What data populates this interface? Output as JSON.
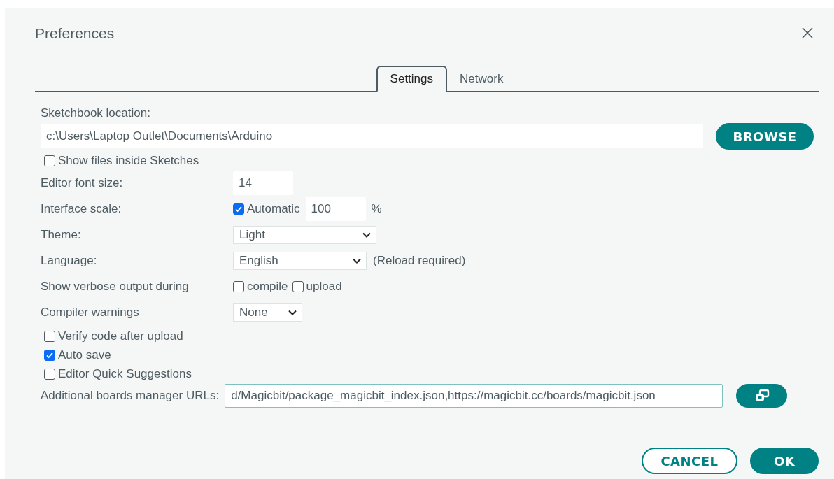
{
  "window": {
    "title": "Preferences"
  },
  "tabs": [
    {
      "label": "Settings",
      "selected": true
    },
    {
      "label": "Network",
      "selected": false
    }
  ],
  "sketchbook": {
    "label": "Sketchbook location:",
    "value": "c:\\Users\\Laptop Outlet\\Documents\\Arduino",
    "button": "BROWSE",
    "show_files": {
      "label": "Show files inside Sketches",
      "checked": false
    }
  },
  "settings": [
    {
      "kind": "input",
      "label": "Editor font size:",
      "value": "14"
    },
    {
      "kind": "scale",
      "label": "Interface scale:",
      "auto": {
        "label": "Automatic",
        "checked": true
      },
      "value": "100",
      "unit": "%"
    },
    {
      "kind": "select",
      "label": "Theme:",
      "value": "Light"
    },
    {
      "kind": "select",
      "label": "Language:",
      "value": "English",
      "note": "(Reload required)"
    },
    {
      "kind": "checks",
      "label": "Show verbose output during",
      "options": [
        {
          "label": "compile",
          "checked": false
        },
        {
          "label": "upload",
          "checked": false
        }
      ]
    },
    {
      "kind": "select",
      "label": "Compiler warnings",
      "value": "None"
    }
  ],
  "options": [
    {
      "label": "Verify code after upload",
      "checked": false
    },
    {
      "label": "Auto save",
      "checked": true
    },
    {
      "label": "Editor Quick Suggestions",
      "checked": false
    }
  ],
  "boards_urls": {
    "label": "Additional boards manager URLs:",
    "value": "d/Magicbit/package_magicbit_index.json,https://magicbit.cc/boards/magicbit.json"
  },
  "buttons": [
    {
      "label": "CANCEL",
      "kind": "secondary"
    },
    {
      "label": "OK",
      "kind": "primary"
    }
  ]
}
